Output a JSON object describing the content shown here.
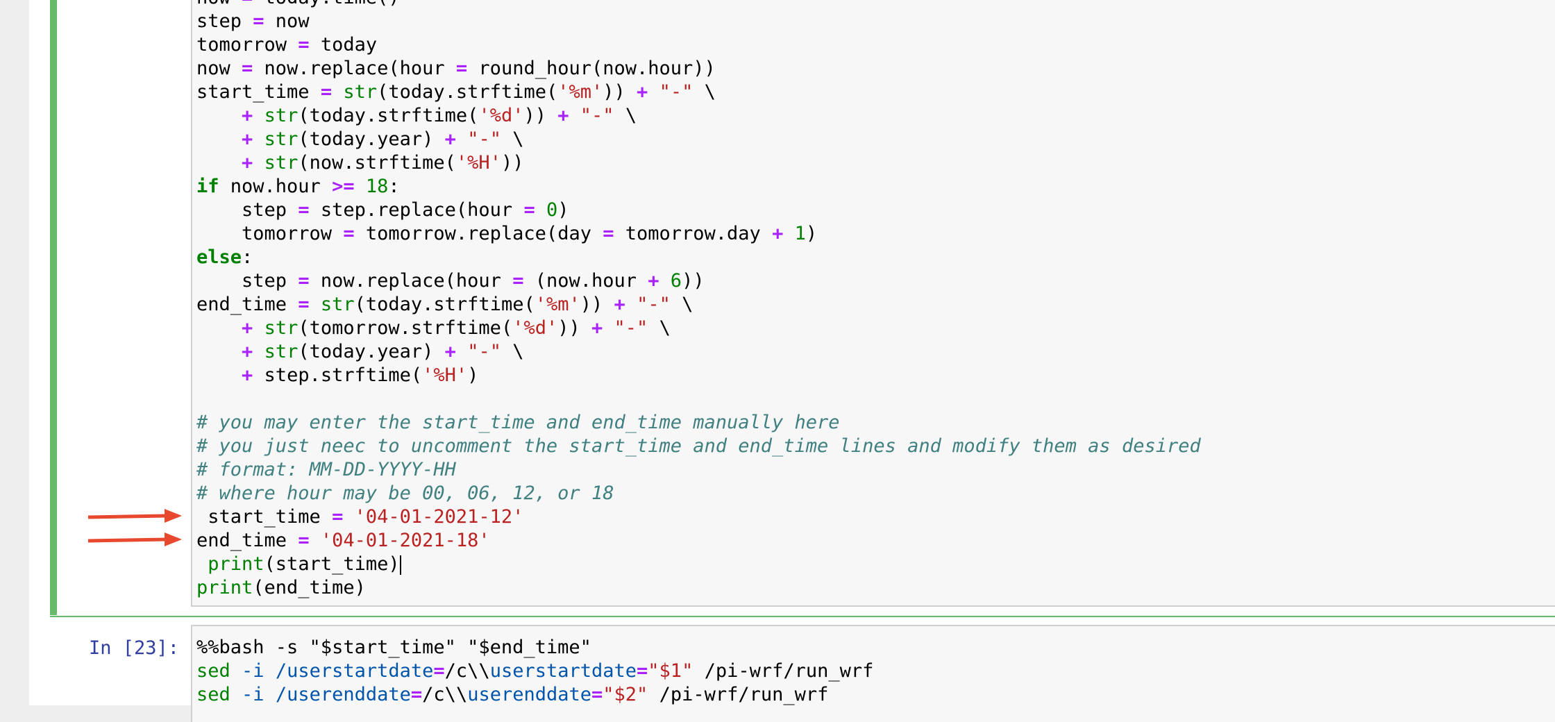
{
  "notebook": {
    "active_cell": {
      "lines": [
        [
          {
            "t": "now ",
            "c": ""
          },
          {
            "t": "=",
            "c": "op"
          },
          {
            "t": " today.time()",
            "c": ""
          }
        ],
        [
          {
            "t": "step ",
            "c": ""
          },
          {
            "t": "=",
            "c": "op"
          },
          {
            "t": " now",
            "c": ""
          }
        ],
        [
          {
            "t": "tomorrow ",
            "c": ""
          },
          {
            "t": "=",
            "c": "op"
          },
          {
            "t": " today",
            "c": ""
          }
        ],
        [
          {
            "t": "now ",
            "c": ""
          },
          {
            "t": "=",
            "c": "op"
          },
          {
            "t": " now.replace(hour ",
            "c": ""
          },
          {
            "t": "=",
            "c": "op"
          },
          {
            "t": " round_hour(now.hour))",
            "c": ""
          }
        ],
        [
          {
            "t": "start_time ",
            "c": ""
          },
          {
            "t": "=",
            "c": "op"
          },
          {
            "t": " ",
            "c": ""
          },
          {
            "t": "str",
            "c": "bi"
          },
          {
            "t": "(today.strftime(",
            "c": ""
          },
          {
            "t": "'%m'",
            "c": "str"
          },
          {
            "t": ")) ",
            "c": ""
          },
          {
            "t": "+",
            "c": "op"
          },
          {
            "t": " ",
            "c": ""
          },
          {
            "t": "\"-\"",
            "c": "str"
          },
          {
            "t": " \\",
            "c": ""
          }
        ],
        [
          {
            "t": "    ",
            "c": ""
          },
          {
            "t": "+",
            "c": "op"
          },
          {
            "t": " ",
            "c": ""
          },
          {
            "t": "str",
            "c": "bi"
          },
          {
            "t": "(today.strftime(",
            "c": ""
          },
          {
            "t": "'%d'",
            "c": "str"
          },
          {
            "t": ")) ",
            "c": ""
          },
          {
            "t": "+",
            "c": "op"
          },
          {
            "t": " ",
            "c": ""
          },
          {
            "t": "\"-\"",
            "c": "str"
          },
          {
            "t": " \\",
            "c": ""
          }
        ],
        [
          {
            "t": "    ",
            "c": ""
          },
          {
            "t": "+",
            "c": "op"
          },
          {
            "t": " ",
            "c": ""
          },
          {
            "t": "str",
            "c": "bi"
          },
          {
            "t": "(today.year) ",
            "c": ""
          },
          {
            "t": "+",
            "c": "op"
          },
          {
            "t": " ",
            "c": ""
          },
          {
            "t": "\"-\"",
            "c": "str"
          },
          {
            "t": " \\",
            "c": ""
          }
        ],
        [
          {
            "t": "    ",
            "c": ""
          },
          {
            "t": "+",
            "c": "op"
          },
          {
            "t": " ",
            "c": ""
          },
          {
            "t": "str",
            "c": "bi"
          },
          {
            "t": "(now.strftime(",
            "c": ""
          },
          {
            "t": "'%H'",
            "c": "str"
          },
          {
            "t": "))",
            "c": ""
          }
        ],
        [
          {
            "t": "if",
            "c": "kw"
          },
          {
            "t": " now.hour ",
            "c": ""
          },
          {
            "t": ">=",
            "c": "op"
          },
          {
            "t": " ",
            "c": ""
          },
          {
            "t": "18",
            "c": "num"
          },
          {
            "t": ":",
            "c": ""
          }
        ],
        [
          {
            "t": "    step ",
            "c": ""
          },
          {
            "t": "=",
            "c": "op"
          },
          {
            "t": " step.replace(hour ",
            "c": ""
          },
          {
            "t": "=",
            "c": "op"
          },
          {
            "t": " ",
            "c": ""
          },
          {
            "t": "0",
            "c": "num"
          },
          {
            "t": ")",
            "c": ""
          }
        ],
        [
          {
            "t": "    tomorrow ",
            "c": ""
          },
          {
            "t": "=",
            "c": "op"
          },
          {
            "t": " tomorrow.replace(day ",
            "c": ""
          },
          {
            "t": "=",
            "c": "op"
          },
          {
            "t": " tomorrow.day ",
            "c": ""
          },
          {
            "t": "+",
            "c": "op"
          },
          {
            "t": " ",
            "c": ""
          },
          {
            "t": "1",
            "c": "num"
          },
          {
            "t": ")",
            "c": ""
          }
        ],
        [
          {
            "t": "else",
            "c": "kw"
          },
          {
            "t": ":",
            "c": ""
          }
        ],
        [
          {
            "t": "    step ",
            "c": ""
          },
          {
            "t": "=",
            "c": "op"
          },
          {
            "t": " now.replace(hour ",
            "c": ""
          },
          {
            "t": "=",
            "c": "op"
          },
          {
            "t": " (now.hour ",
            "c": ""
          },
          {
            "t": "+",
            "c": "op"
          },
          {
            "t": " ",
            "c": ""
          },
          {
            "t": "6",
            "c": "num"
          },
          {
            "t": "))",
            "c": ""
          }
        ],
        [
          {
            "t": "end_time ",
            "c": ""
          },
          {
            "t": "=",
            "c": "op"
          },
          {
            "t": " ",
            "c": ""
          },
          {
            "t": "str",
            "c": "bi"
          },
          {
            "t": "(today.strftime(",
            "c": ""
          },
          {
            "t": "'%m'",
            "c": "str"
          },
          {
            "t": ")) ",
            "c": ""
          },
          {
            "t": "+",
            "c": "op"
          },
          {
            "t": " ",
            "c": ""
          },
          {
            "t": "\"-\"",
            "c": "str"
          },
          {
            "t": " \\",
            "c": ""
          }
        ],
        [
          {
            "t": "    ",
            "c": ""
          },
          {
            "t": "+",
            "c": "op"
          },
          {
            "t": " ",
            "c": ""
          },
          {
            "t": "str",
            "c": "bi"
          },
          {
            "t": "(tomorrow.strftime(",
            "c": ""
          },
          {
            "t": "'%d'",
            "c": "str"
          },
          {
            "t": ")) ",
            "c": ""
          },
          {
            "t": "+",
            "c": "op"
          },
          {
            "t": " ",
            "c": ""
          },
          {
            "t": "\"-\"",
            "c": "str"
          },
          {
            "t": " \\",
            "c": ""
          }
        ],
        [
          {
            "t": "    ",
            "c": ""
          },
          {
            "t": "+",
            "c": "op"
          },
          {
            "t": " ",
            "c": ""
          },
          {
            "t": "str",
            "c": "bi"
          },
          {
            "t": "(today.year) ",
            "c": ""
          },
          {
            "t": "+",
            "c": "op"
          },
          {
            "t": " ",
            "c": ""
          },
          {
            "t": "\"-\"",
            "c": "str"
          },
          {
            "t": " \\",
            "c": ""
          }
        ],
        [
          {
            "t": "    ",
            "c": ""
          },
          {
            "t": "+",
            "c": "op"
          },
          {
            "t": " step.strftime(",
            "c": ""
          },
          {
            "t": "'%H'",
            "c": "str"
          },
          {
            "t": ")",
            "c": ""
          }
        ],
        [],
        [
          {
            "t": "# you may enter the start_time and end_time manually here",
            "c": "cmt"
          }
        ],
        [
          {
            "t": "# you just neec to uncomment the start_time and end_time lines and modify them as desired",
            "c": "cmt"
          }
        ],
        [
          {
            "t": "# format: MM-DD-YYYY-HH",
            "c": "cmt"
          }
        ],
        [
          {
            "t": "# where hour may be 00, 06, 12, or 18",
            "c": "cmt"
          }
        ],
        [
          {
            "t": " start_time ",
            "c": ""
          },
          {
            "t": "=",
            "c": "op"
          },
          {
            "t": " ",
            "c": ""
          },
          {
            "t": "'04-01-2021-12'",
            "c": "str"
          }
        ],
        [
          {
            "t": "end_time ",
            "c": ""
          },
          {
            "t": "=",
            "c": "op"
          },
          {
            "t": " ",
            "c": ""
          },
          {
            "t": "'04-01-2021-18'",
            "c": "str"
          }
        ],
        [
          {
            "t": " ",
            "c": ""
          },
          {
            "t": "print",
            "c": "bi"
          },
          {
            "t": "(start_time)",
            "c": ""
          },
          {
            "t": "",
            "c": "caret"
          }
        ],
        [
          {
            "t": "print",
            "c": "bi"
          },
          {
            "t": "(end_time)",
            "c": ""
          }
        ]
      ]
    },
    "next_cell": {
      "prompt": "In [23]:",
      "lines": [
        [
          {
            "t": "%%bash -s \"$start_time\" \"$end_time\"",
            "c": ""
          }
        ],
        [
          {
            "t": "sed",
            "c": "bi"
          },
          {
            "t": " ",
            "c": ""
          },
          {
            "t": "-i",
            "c": "bash-var"
          },
          {
            "t": " ",
            "c": ""
          },
          {
            "t": "/userstartdate",
            "c": "bash-var"
          },
          {
            "t": "=",
            "c": "op"
          },
          {
            "t": "/c\\\\",
            "c": ""
          },
          {
            "t": "userstartdate",
            "c": "bash-var"
          },
          {
            "t": "=",
            "c": "op"
          },
          {
            "t": "\"$1\"",
            "c": "str"
          },
          {
            "t": " /pi-wrf/run_wrf",
            "c": ""
          }
        ],
        [
          {
            "t": "sed",
            "c": "bi"
          },
          {
            "t": " ",
            "c": ""
          },
          {
            "t": "-i",
            "c": "bash-var"
          },
          {
            "t": " ",
            "c": ""
          },
          {
            "t": "/userenddate",
            "c": "bash-var"
          },
          {
            "t": "=",
            "c": "op"
          },
          {
            "t": "/c\\\\",
            "c": ""
          },
          {
            "t": "userenddate",
            "c": "bash-var"
          },
          {
            "t": "=",
            "c": "op"
          },
          {
            "t": "\"$2\"",
            "c": "str"
          },
          {
            "t": " /pi-wrf/run_wrf",
            "c": ""
          }
        ]
      ]
    }
  },
  "annotations": {
    "arrow_color": "#e8482e",
    "arrows": [
      {
        "target_line": "start_time"
      },
      {
        "target_line": "end_time"
      }
    ]
  }
}
